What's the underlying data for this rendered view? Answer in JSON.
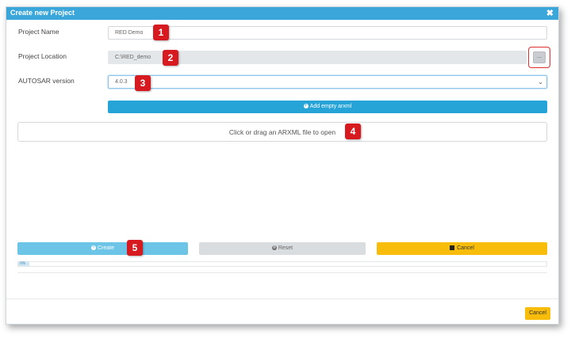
{
  "window": {
    "title": "Create new Project",
    "close_glyph": "✖"
  },
  "form": {
    "project_name_label": "Project Name",
    "project_name_value": "RED Demo",
    "project_location_label": "Project Location",
    "project_location_value": "C:\\RED_demo",
    "browse_label": "...",
    "autosar_version_label": "AUTOSAR version",
    "autosar_version_value": "4.0.3",
    "chevron_glyph": "⌄"
  },
  "actions": {
    "add_empty_arxml": "Add empty arxml",
    "dropzone_text": "Click or drag an ARXML file to open",
    "create": "Create",
    "reset": "Reset",
    "cancel": "Cancel",
    "plus_glyph": "+",
    "reset_glyph": "⊗"
  },
  "progress": {
    "value_label": "0%",
    "value": 0
  },
  "footer": {
    "cancel": "Cancel"
  },
  "callouts": [
    "1",
    "2",
    "3",
    "4",
    "5"
  ],
  "colors": {
    "titlebar": "#3aa6d9",
    "primary": "#27a4d7",
    "create": "#6cc5e6",
    "reset": "#dadddf",
    "cancel": "#f7bd0a",
    "callout": "#d71920",
    "highlight": "#e03030"
  },
  "icons": {
    "close": "close-icon",
    "plus": "plus-circle-icon",
    "reset": "reset-circle-icon",
    "stop": "stop-square-icon",
    "chevron": "chevron-down-icon"
  }
}
